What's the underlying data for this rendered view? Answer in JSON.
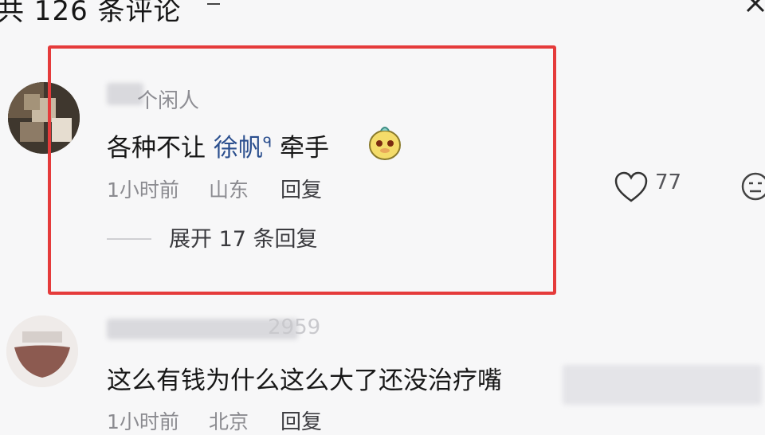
{
  "header": {
    "title": "共 126 条评论",
    "sort_icon": "filter-lines-icon",
    "close_icon": "close-icon"
  },
  "comments": [
    {
      "username": "个闲人",
      "text_before": "各种不让",
      "mention": "徐帆",
      "mention_suffix": "ᑫ",
      "text_after": "牵手",
      "emoji": "yellow-face-emoji",
      "time": "1小时前",
      "location": "山东",
      "reply_label": "回复",
      "like_count": "77",
      "expand_label": "展开 17 条回复"
    },
    {
      "username": "2959",
      "text": "这么有钱为什么这么大了还没治疗嘴",
      "time": "1小时前",
      "location": "北京",
      "reply_label": "回复"
    }
  ],
  "colors": {
    "highlight": "#e53b3b",
    "mention": "#2b4f8e",
    "background": "#f7f7f8"
  }
}
